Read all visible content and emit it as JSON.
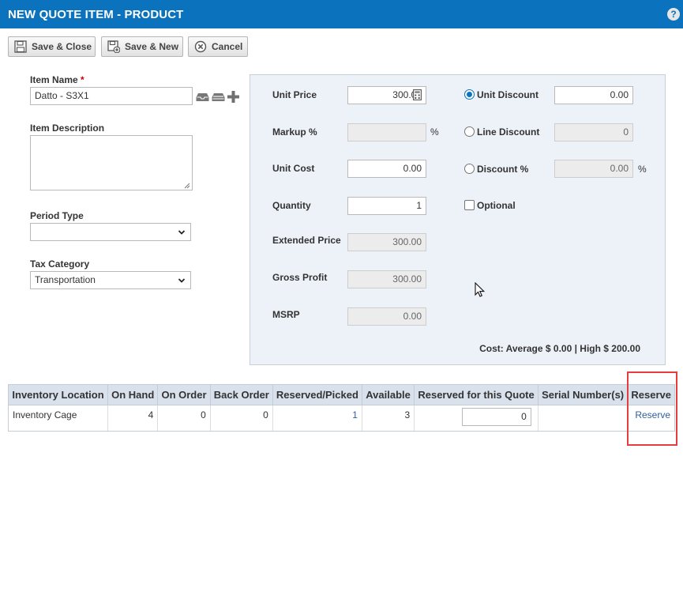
{
  "title": "NEW QUOTE ITEM - PRODUCT",
  "help": "?",
  "toolbar": {
    "save_close": "Save & Close",
    "save_new": "Save & New",
    "cancel": "Cancel"
  },
  "form": {
    "item_name_label": "Item Name",
    "required_mark": "*",
    "item_name_value": "Datto - S3X1",
    "item_description_label": "Item Description",
    "item_description_value": "",
    "period_type_label": "Period Type",
    "period_type_value": "",
    "tax_category_label": "Tax Category",
    "tax_category_value": "Transportation"
  },
  "pricing": {
    "unit_price_label": "Unit Price",
    "unit_price_value": "300.00",
    "markup_label": "Markup %",
    "markup_value": "",
    "percent": "%",
    "unit_cost_label": "Unit Cost",
    "unit_cost_value": "0.00",
    "quantity_label": "Quantity",
    "quantity_value": "1",
    "extended_price_label": "Extended Price",
    "extended_price_value": "300.00",
    "gross_profit_label": "Gross Profit",
    "gross_profit_value": "300.00",
    "msrp_label": "MSRP",
    "msrp_value": "0.00",
    "unit_discount_label": "Unit Discount",
    "unit_discount_value": "0.00",
    "line_discount_label": "Line Discount",
    "line_discount_value": "0",
    "discount_pct_label": "Discount %",
    "discount_pct_value": "0.00",
    "optional_label": "Optional",
    "cost_summary": "Cost:  Average  $ 0.00 | High  $ 200.00"
  },
  "inventory": {
    "headers": [
      "Inventory Location",
      "On Hand",
      "On Order",
      "Back Order",
      "Reserved/Picked",
      "Available",
      "Reserved for this Quote",
      "Serial Number(s)",
      "Reserve"
    ],
    "row": {
      "location": "Inventory Cage",
      "on_hand": "4",
      "on_order": "0",
      "back_order": "0",
      "reserved_picked": "1",
      "available": "3",
      "reserved_for_quote": "0",
      "serial_numbers": "",
      "reserve_link": "Reserve"
    }
  },
  "colors": {
    "header_blue": "#0b73bd",
    "panel_bg": "#edf2f8",
    "highlight_red": "#e53e3e",
    "link_blue": "#2f5f9e"
  }
}
